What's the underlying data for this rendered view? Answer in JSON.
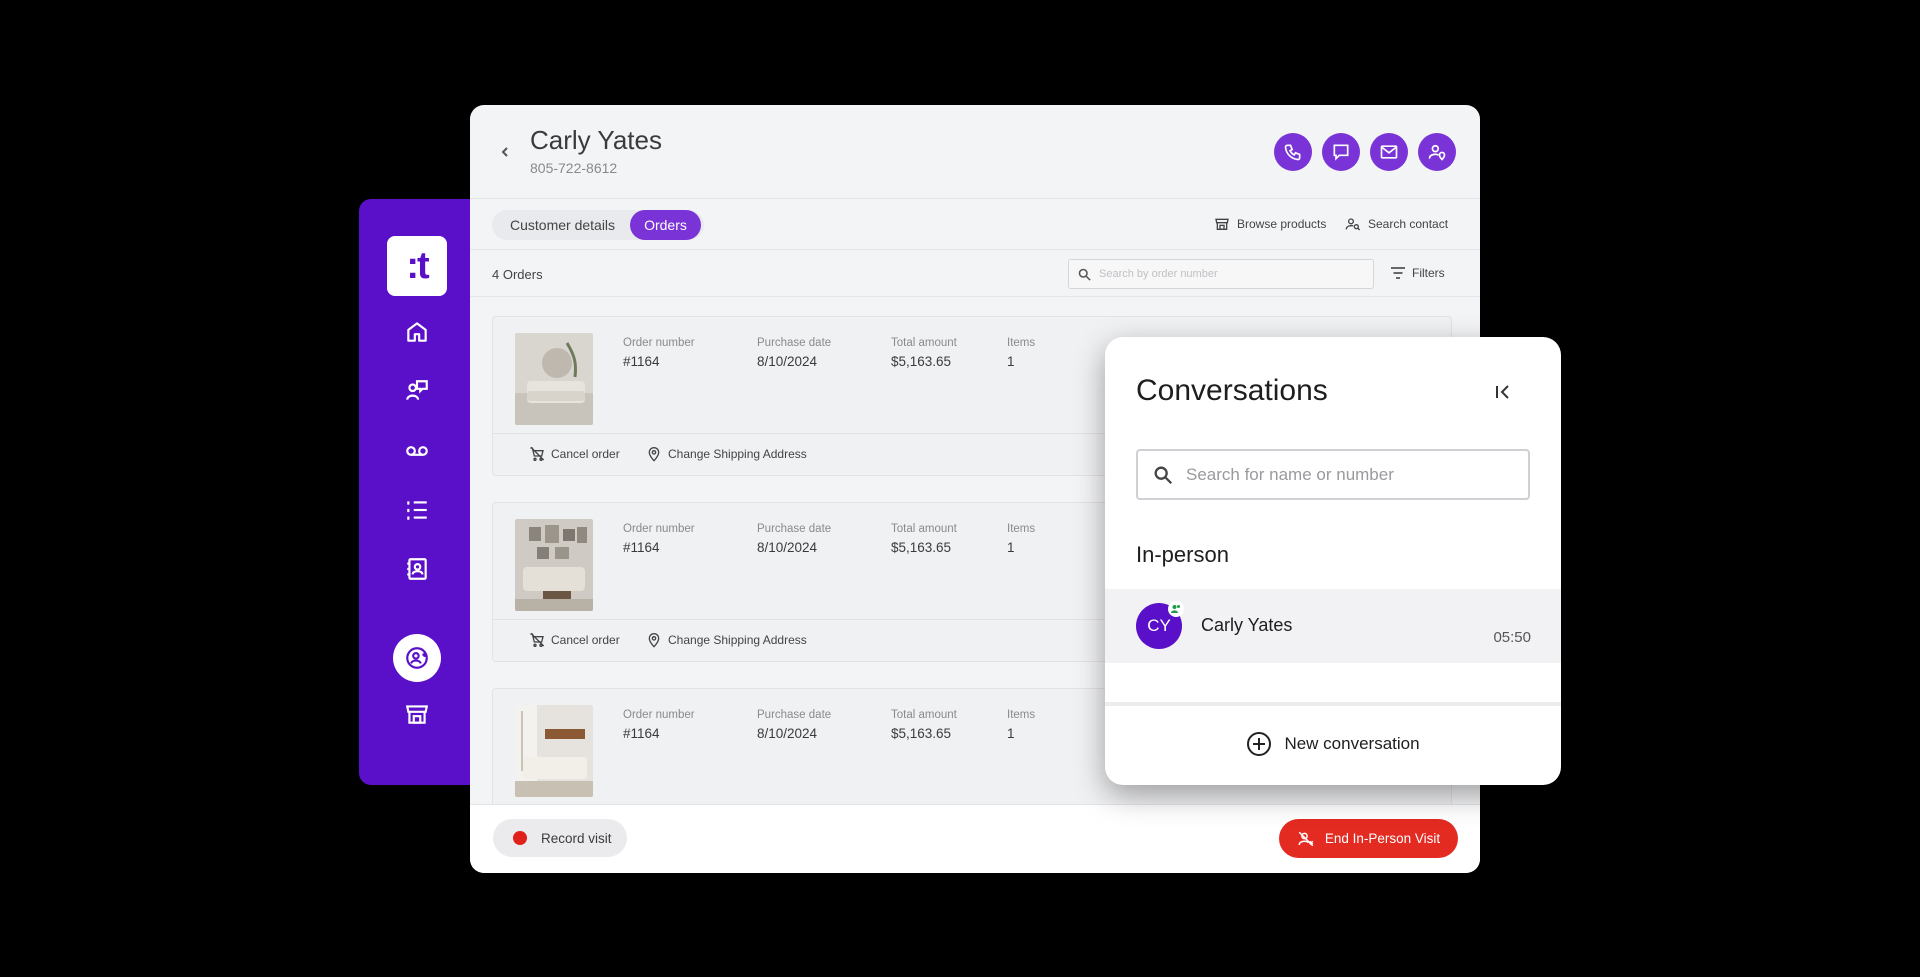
{
  "app": {
    "logo_text": ":t",
    "brand_color": "#5a0fc8",
    "accent_color": "#7a33d6",
    "danger_color": "#e32b22"
  },
  "sidebar": {
    "items": [
      {
        "name": "home",
        "icon": "home-icon"
      },
      {
        "name": "conversations",
        "icon": "chat-person-icon"
      },
      {
        "name": "voicemail",
        "icon": "voicemail-icon"
      },
      {
        "name": "tasks",
        "icon": "list-icon"
      },
      {
        "name": "contacts",
        "icon": "contact-book-icon"
      },
      {
        "name": "in-person",
        "icon": "person-add-icon",
        "active": true
      },
      {
        "name": "store",
        "icon": "store-icon"
      }
    ]
  },
  "customer": {
    "name": "Carly Yates",
    "phone": "805-722-8612"
  },
  "header_actions": [
    "phone-icon",
    "message-icon",
    "mail-icon",
    "person-location-icon"
  ],
  "tabs": {
    "customer_details": "Customer details",
    "orders": "Orders"
  },
  "links": {
    "browse_products": "Browse products",
    "search_contact": "Search contact"
  },
  "orders": {
    "count_label": "4 Orders",
    "search_placeholder": "Search by order number",
    "filters_label": "Filters",
    "columns": {
      "order_number": "Order number",
      "purchase_date": "Purchase date",
      "total_amount": "Total amount",
      "items": "Items"
    },
    "rows": [
      {
        "order_number": "#1164",
        "purchase_date": "8/10/2024",
        "total_amount": "$5,163.65",
        "items": "1"
      },
      {
        "order_number": "#1164",
        "purchase_date": "8/10/2024",
        "total_amount": "$5,163.65",
        "items": "1"
      },
      {
        "order_number": "#1164",
        "purchase_date": "8/10/2024",
        "total_amount": "$5,163.65",
        "items": "1"
      }
    ],
    "actions": {
      "cancel": "Cancel order",
      "change_address": "Change Shipping Address"
    }
  },
  "footer": {
    "record_visit": "Record visit",
    "end_visit": "End In-Person Visit"
  },
  "conversations": {
    "title": "Conversations",
    "search_placeholder": "Search for name or number",
    "section": "In-person",
    "items": [
      {
        "initials": "CY",
        "name": "Carly Yates",
        "time": "05:50"
      }
    ],
    "new_conversation": "New conversation"
  }
}
